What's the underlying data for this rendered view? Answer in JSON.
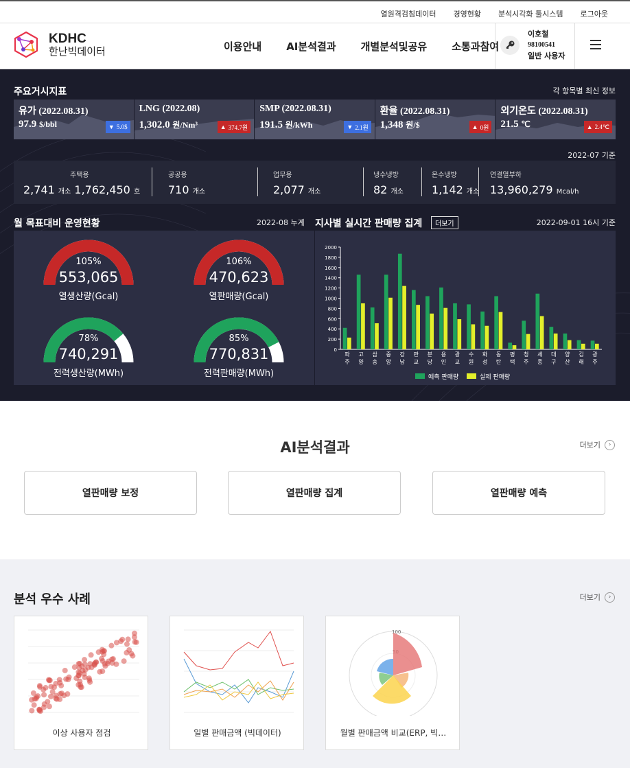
{
  "topbar": {
    "links": [
      "열원격검침데이터",
      "경영현황",
      "분석시각화 툴시스템",
      "로그아웃"
    ]
  },
  "header": {
    "logo_en": "KDHC",
    "logo_ko": "한난빅데이터",
    "nav": [
      "이용안내",
      "AI분석결과",
      "개별분석및공유",
      "소통과참여"
    ],
    "user": {
      "name": "이호철",
      "id": "98100541",
      "role": "일반 사용자"
    }
  },
  "indicators": {
    "title": "주요거시지표",
    "note": "각 항목별 최신 정보",
    "items": [
      {
        "label": "유가 (2022.08.31)",
        "value": "97.9",
        "unit": "$/bbl",
        "change": "5.0$",
        "direction": "down"
      },
      {
        "label": "LNG (2022.08)",
        "value": "1,302.0",
        "unit": "원/Nm³",
        "change": "374.7원",
        "direction": "up"
      },
      {
        "label": "SMP (2022.08.31)",
        "value": "191.5",
        "unit": "원/kWh",
        "change": "2.1원",
        "direction": "down"
      },
      {
        "label": "환율 (2022.08.31)",
        "value": "1,348",
        "unit": "원/$",
        "change": "0원",
        "direction": "up"
      },
      {
        "label": "외기온도 (2022.08.31)",
        "value": "21.5",
        "unit": "℃",
        "change": "2.4℃",
        "direction": "up"
      }
    ]
  },
  "facilities": {
    "note": "2022-07 기준",
    "residential": {
      "label": "주택용",
      "count": "2,741",
      "count_unit": "개소",
      "households": "1,762,450",
      "households_unit": "호"
    },
    "public": {
      "label": "공공용",
      "count": "710",
      "unit": "개소"
    },
    "business": {
      "label": "업무용",
      "count": "2,077",
      "unit": "개소"
    },
    "cold_cooling": {
      "label": "냉수냉방",
      "count": "82",
      "unit": "개소"
    },
    "hot_cooling": {
      "label": "온수냉방",
      "count": "1,142",
      "unit": "개소"
    },
    "connected_load": {
      "label": "연결열부하",
      "value": "13,960,279",
      "unit": "Mcal/h"
    }
  },
  "operations": {
    "title": "월 목표대비 운영현황",
    "note": "2022-08 누계",
    "gauges": [
      {
        "percent": "105%",
        "fraction": 1.05,
        "value": "553,065",
        "label": "열생산량(Gcal)",
        "color": "#c62828"
      },
      {
        "percent": "106%",
        "fraction": 1.06,
        "value": "470,623",
        "label": "열판매량(Gcal)",
        "color": "#c62828"
      },
      {
        "percent": "78%",
        "fraction": 0.78,
        "value": "740,291",
        "label": "전력생산량(MWh)",
        "color": "#1fa35c"
      },
      {
        "percent": "85%",
        "fraction": 0.85,
        "value": "770,831",
        "label": "전력판매량(MWh)",
        "color": "#1fa35c"
      }
    ]
  },
  "realtime": {
    "title": "지사별 실시간 판매량 집계",
    "more": "더보기",
    "note": "2022-09-01 16시 기준"
  },
  "chart_data": {
    "type": "bar",
    "categories": [
      "파주",
      "고양",
      "삼송",
      "중앙",
      "강남",
      "판교",
      "분당",
      "용인",
      "광교",
      "수원",
      "화성",
      "동탄",
      "평택",
      "청주",
      "세종",
      "대구",
      "양산",
      "김해",
      "광주"
    ],
    "series": [
      {
        "name": "예측 판매량",
        "color": "#1fa35c",
        "values": [
          420,
          1460,
          820,
          1460,
          1870,
          1160,
          1040,
          1210,
          900,
          880,
          740,
          1040,
          130,
          560,
          1090,
          440,
          310,
          180,
          170
        ]
      },
      {
        "name": "실제 판매량",
        "color": "#e3ef2b",
        "values": [
          230,
          900,
          510,
          1010,
          1240,
          870,
          700,
          810,
          590,
          490,
          460,
          730,
          80,
          300,
          650,
          310,
          180,
          110,
          110
        ]
      }
    ],
    "ylim": [
      0,
      2000
    ],
    "yticks": [
      0,
      200,
      400,
      600,
      800,
      1000,
      1200,
      1400,
      1600,
      1800,
      2000
    ],
    "legend": "bottom"
  },
  "ai_section": {
    "title": "AI분석결과",
    "more": "더보기",
    "cards": [
      "열판매량 보정",
      "열판매량 집계",
      "열판매량 예측"
    ]
  },
  "cases_section": {
    "title": "분석 우수 사례",
    "more": "더보기",
    "cards": [
      "이상 사용자 점검",
      "일별 판매금액 (빅데이터)",
      "월별 판매금액 비교(ERP, 빅…"
    ],
    "polar_ticks": [
      "100",
      "50"
    ]
  }
}
